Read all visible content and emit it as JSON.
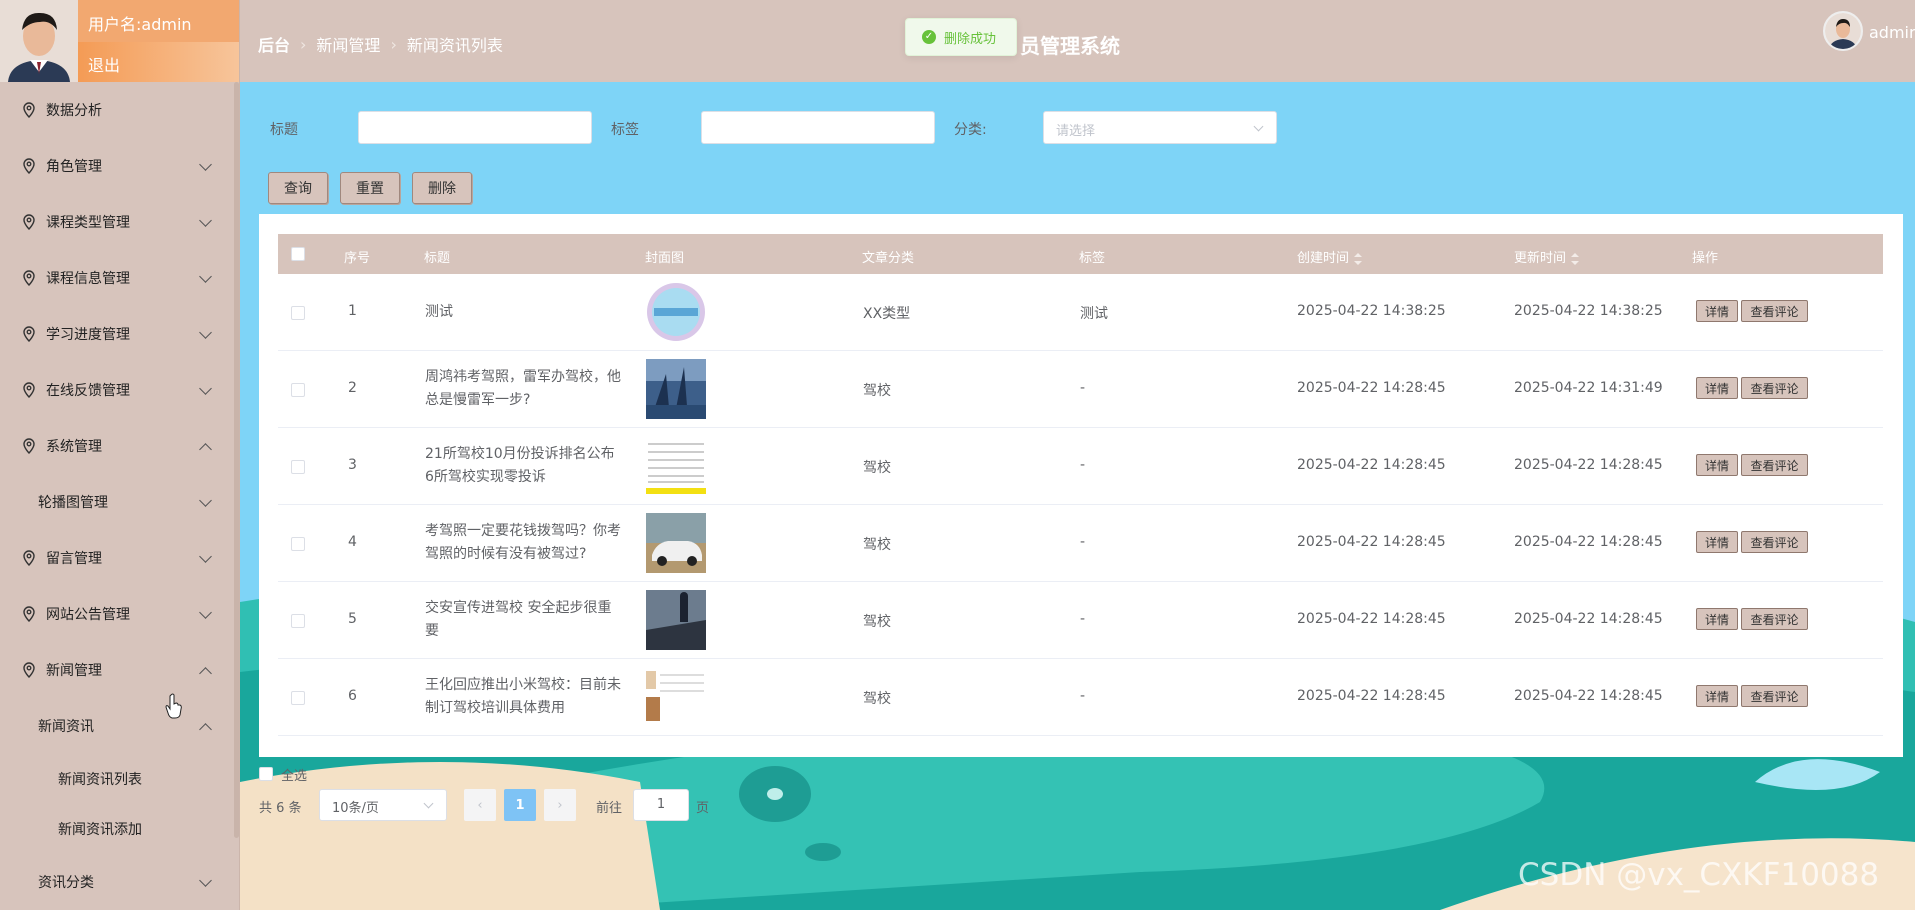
{
  "user": {
    "name_label": "用户名:admin",
    "logout": "退出"
  },
  "sidebar": {
    "items": [
      {
        "label": "数据分析"
      },
      {
        "label": "角色管理"
      },
      {
        "label": "课程类型管理"
      },
      {
        "label": "课程信息管理"
      },
      {
        "label": "学习进度管理"
      },
      {
        "label": "在线反馈管理"
      },
      {
        "label": "系统管理"
      },
      {
        "label": "轮播图管理"
      },
      {
        "label": "留言管理"
      },
      {
        "label": "网站公告管理"
      },
      {
        "label": "新闻管理"
      },
      {
        "label": "新闻资讯"
      },
      {
        "label": "新闻资讯列表"
      },
      {
        "label": "新闻资讯添加"
      },
      {
        "label": "资讯分类"
      }
    ]
  },
  "header": {
    "breadcrumb": [
      "后台",
      "新闻管理",
      "新闻资讯列表"
    ],
    "title_visible": "员管理系统",
    "toast": "删除成功",
    "username": "admin"
  },
  "search": {
    "title_label": "标题",
    "tag_label": "标签",
    "category_label": "分类:",
    "category_placeholder": "请选择",
    "query_btn": "查询",
    "reset_btn": "重置",
    "delete_btn": "删除"
  },
  "table": {
    "columns": [
      "序号",
      "标题",
      "封面图",
      "文章分类",
      "标签",
      "创建时间",
      "更新时间",
      "操作"
    ],
    "rows": [
      {
        "no": "1",
        "title": "测试",
        "category": "XX类型",
        "tag": "测试",
        "created": "2025-04-22 14:38:25",
        "updated": "2025-04-22 14:38:25"
      },
      {
        "no": "2",
        "title": "周鸿祎考驾照，雷军办驾校，他总是慢雷军一步?",
        "category": "驾校",
        "tag": "-",
        "created": "2025-04-22 14:28:45",
        "updated": "2025-04-22 14:31:49"
      },
      {
        "no": "3",
        "title": "21所驾校10月份投诉排名公布 6所驾校实现零投诉",
        "category": "驾校",
        "tag": "-",
        "created": "2025-04-22 14:28:45",
        "updated": "2025-04-22 14:28:45"
      },
      {
        "no": "4",
        "title": "考驾照一定要花钱拨驾吗？你考驾照的时候有没有被驾过?",
        "category": "驾校",
        "tag": "-",
        "created": "2025-04-22 14:28:45",
        "updated": "2025-04-22 14:28:45"
      },
      {
        "no": "5",
        "title": "交安宣传进驾校 安全起步很重要",
        "category": "驾校",
        "tag": "-",
        "created": "2025-04-22 14:28:45",
        "updated": "2025-04-22 14:28:45"
      },
      {
        "no": "6",
        "title": "王化回应推出小米驾校：目前未制订驾校培训具体费用",
        "category": "驾校",
        "tag": "-",
        "created": "2025-04-22 14:28:45",
        "updated": "2025-04-22 14:28:45"
      }
    ],
    "detail_btn": "详情",
    "comment_btn": "查看评论",
    "select_all": "全选"
  },
  "pager": {
    "total": "共 6 条",
    "page_size": "10条/页",
    "current": "1",
    "goto_label": "前往",
    "goto_value": "1",
    "page_unit": "页"
  },
  "watermark": "CSDN @vx_CXKF10088",
  "colors": {
    "primary": "#d7c4bc",
    "accent": "#f2a870",
    "background": "#7ed4f7",
    "success": "#67c23a"
  }
}
